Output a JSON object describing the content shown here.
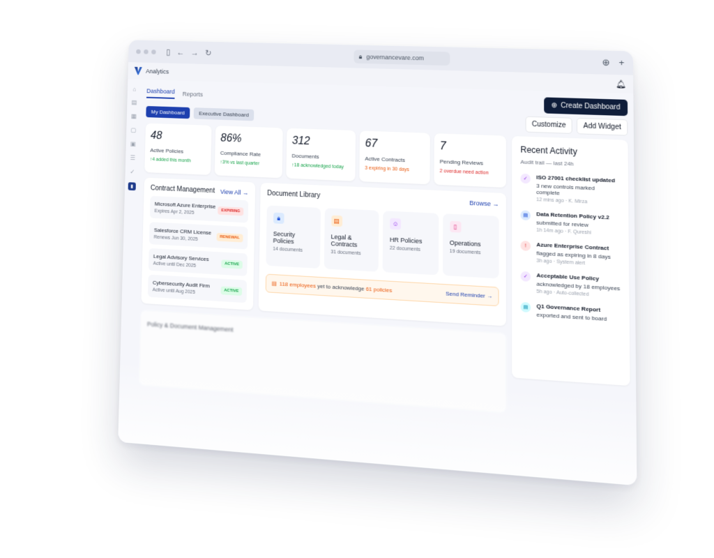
{
  "browser": {
    "url": "governancevare.com"
  },
  "app": {
    "title": "Analytics"
  },
  "tabs": [
    "Dashboard",
    "Reports"
  ],
  "header": {
    "create_label": "Create Dashboard"
  },
  "subnav": {
    "my_dashboard": "My Dashboard",
    "executive": "Executive Dashboard",
    "customize": "Customize",
    "add_widget": "Add Widget"
  },
  "stats": [
    {
      "num": "48",
      "label": "Active Policies",
      "note": "↑4 added this month"
    },
    {
      "num": "86%",
      "label": "Compliance Rate",
      "note": "↑3% vs last quarter"
    },
    {
      "num": "312",
      "label": "Documents",
      "note": "↑18 acknowledged today"
    },
    {
      "num": "67",
      "label": "Active Contracts",
      "note": "3 expiring in 30 days"
    },
    {
      "num": "7",
      "label": "Pending Reviews",
      "note": "2 overdue need action"
    }
  ],
  "contracts": {
    "title": "Contract Management",
    "view_all": "View All →",
    "items": [
      {
        "name": "Microsoft Azure Enterprise",
        "sub": "Expires Apr 2, 2025",
        "badge": "EXPIRING"
      },
      {
        "name": "Salesforce CRM License",
        "sub": "Renews Jun 30, 2025",
        "badge": "RENEWAL"
      },
      {
        "name": "Legal Advisory Services",
        "sub": "Active until Dec 2025",
        "badge": "ACTIVE"
      },
      {
        "name": "Cybersecurity Audit Firm",
        "sub": "Active until Aug 2025",
        "badge": "ACTIVE"
      }
    ]
  },
  "library": {
    "title": "Document Library",
    "browse": "Browse →",
    "items": [
      {
        "name": "Security Policies",
        "count": "14 documents"
      },
      {
        "name": "Legal & Contracts",
        "count": "31 documents"
      },
      {
        "name": "HR Policies",
        "count": "22 documents"
      },
      {
        "name": "Operations",
        "count": "19 documents"
      }
    ],
    "alert_a": "118 employees",
    "alert_b": " yet to acknowledge ",
    "alert_c": "61 policies",
    "send": "Send Reminder →"
  },
  "activity": {
    "title": "Recent Activity",
    "sub": "Audit trail — last 24h",
    "items": [
      {
        "name": "ISO 27001 checklist updated",
        "desc": "3 new controls marked complete",
        "meta": "12 mins ago · K. Mirza"
      },
      {
        "name": "Data Retention Policy v2.2",
        "desc": "submitted for review",
        "meta": "1h 14m ago · F. Qureshi"
      },
      {
        "name": "Azure Enterprise Contract",
        "desc": "flagged as expiring in 8 days",
        "meta": "3h ago · System alert"
      },
      {
        "name": "Acceptable Use Policy",
        "desc": "acknowledged by 18 employees",
        "meta": "5h ago · Auto-collected"
      },
      {
        "name": "Q1 Governance Report",
        "desc": "exported and sent to board",
        "meta": ""
      }
    ]
  },
  "policy": {
    "title": "Policy & Document Management"
  }
}
